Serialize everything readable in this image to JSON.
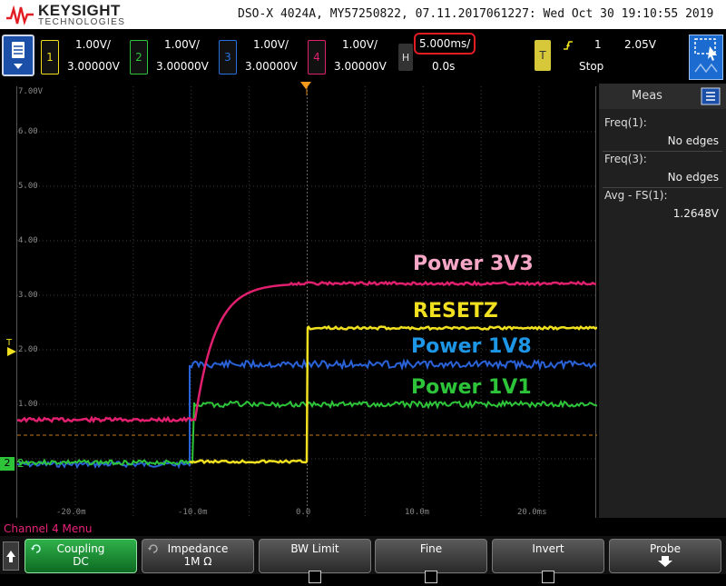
{
  "header": {
    "brand": "KEYSIGHT",
    "brand_sub": "TECHNOLOGIES",
    "title": "DSO-X 4024A, MY57250822, 07.11.2017061227: Wed Oct 30 19:10:55 2019"
  },
  "channels": [
    {
      "num": "1",
      "scale": "1.00V/",
      "offset": "3.00000V",
      "color": "#f0e020"
    },
    {
      "num": "2",
      "scale": "1.00V/",
      "offset": "3.00000V",
      "color": "#2ec43a"
    },
    {
      "num": "3",
      "scale": "1.00V/",
      "offset": "3.00000V",
      "color": "#2a6fe0"
    },
    {
      "num": "4",
      "scale": "1.00V/",
      "offset": "3.00000V",
      "color": "#e0206e"
    }
  ],
  "horizontal": {
    "chip": "H",
    "timebase": "5.000ms/",
    "delay": "0.0s"
  },
  "trigger": {
    "chip": "T",
    "icon": "rising-edge-icon",
    "source": "1",
    "level": "2.05V",
    "status": "Stop"
  },
  "grid": {
    "y_labels": [
      "7.00V",
      "6.00",
      "5.00",
      "4.00",
      "3.00",
      "2.00",
      "1.00"
    ],
    "x_labels": [
      "-20.0m",
      "-10.0m",
      "0.0",
      "10.0m",
      "20.0ms"
    ],
    "trigger_marker": "T",
    "ground_marker": "2"
  },
  "trace_labels": {
    "power_3v3": "Power 3V3",
    "resetz": "RESETZ",
    "power_1v8": "Power 1V8",
    "power_1v1": "Power 1V1"
  },
  "side_panel": {
    "title": "Meas",
    "measurements": [
      {
        "label": "Freq(1):",
        "value": "No edges"
      },
      {
        "label": "Freq(3):",
        "value": "No edges"
      },
      {
        "label": "Avg - FS(1):",
        "value": "1.2648V"
      }
    ]
  },
  "menu": {
    "title": "Channel 4 Menu"
  },
  "softkeys": [
    {
      "label": "Coupling",
      "value": "DC"
    },
    {
      "label": "Impedance",
      "value": "1M Ω"
    },
    {
      "label": "BW Limit",
      "value": ""
    },
    {
      "label": "Fine",
      "value": ""
    },
    {
      "label": "Invert",
      "value": ""
    },
    {
      "label": "Probe",
      "value": ""
    }
  ]
}
